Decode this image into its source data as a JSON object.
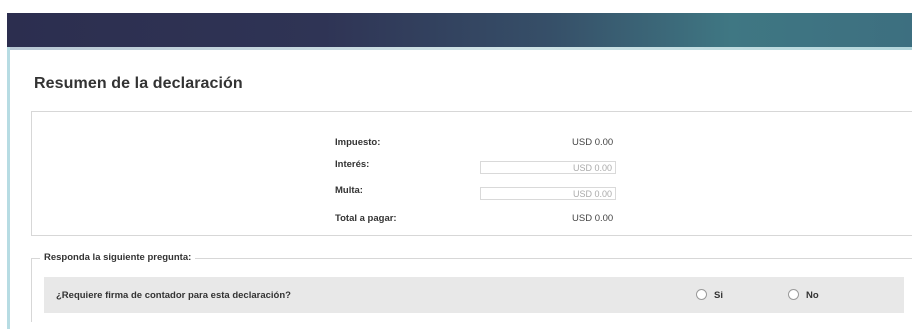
{
  "page": {
    "title": "Resumen de la declaración"
  },
  "summary": {
    "impuesto": {
      "label": "Impuesto:",
      "value": "USD 0.00"
    },
    "interes": {
      "label": "Interés:",
      "value": "USD 0.00"
    },
    "multa": {
      "label": "Multa:",
      "value": "USD 0.00"
    },
    "total": {
      "label": "Total a pagar:",
      "value": "USD 0.00"
    }
  },
  "question_section": {
    "legend": "Responda la siguiente pregunta:",
    "question": "¿Requiere firma de contador para esta declaración?",
    "options": [
      {
        "label": "Si",
        "selected": false
      },
      {
        "label": "No",
        "selected": false
      }
    ]
  },
  "colors": {
    "header_start": "#2c2e4f",
    "header_end": "#3d6f80",
    "accent_rule": "#b7dce3",
    "question_row_bg": "#e8e8e8"
  }
}
